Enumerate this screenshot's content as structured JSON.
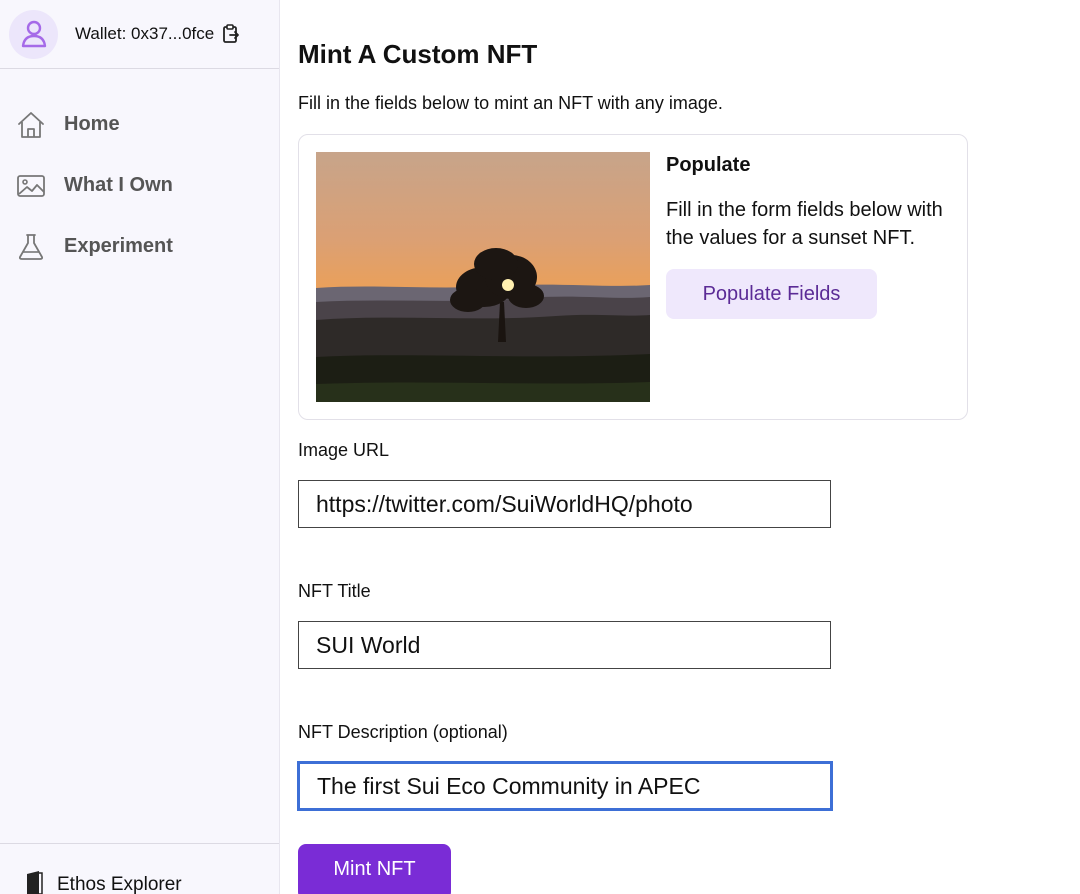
{
  "sidebar": {
    "wallet_label": "Wallet: 0x37...0fce",
    "wallet_icon": "user-icon",
    "copy_icon": "clipboard-copy-icon",
    "items": [
      {
        "label": "Home",
        "icon": "home-icon"
      },
      {
        "label": "What I Own",
        "icon": "image-gallery-icon"
      },
      {
        "label": "Experiment",
        "icon": "flask-icon"
      }
    ],
    "footer_label": "Ethos Explorer",
    "footer_icon": "book-icon"
  },
  "main": {
    "title": "Mint A Custom NFT",
    "subtitle": "Fill in the fields below to mint an NFT with any image.",
    "populate_card": {
      "image": "sunset-photo",
      "heading": "Populate",
      "text": "Fill in the form fields below with the values for a sunset NFT.",
      "button_label": "Populate Fields"
    },
    "form": {
      "image_url_label": "Image URL",
      "image_url_value": "https://twitter.com/SuiWorldHQ/photo",
      "title_label": "NFT Title",
      "title_value": "SUI World",
      "description_label": "NFT Description (optional)",
      "description_value": "The first Sui Eco Community in APEC",
      "submit_label": "Mint NFT"
    }
  },
  "colors": {
    "accent": "#7a2cd6",
    "accent_light": "#efe8fc",
    "accent_text": "#5b2b96",
    "sidebar_bg": "#f8f7fd",
    "focus": "#3d6fd6"
  }
}
